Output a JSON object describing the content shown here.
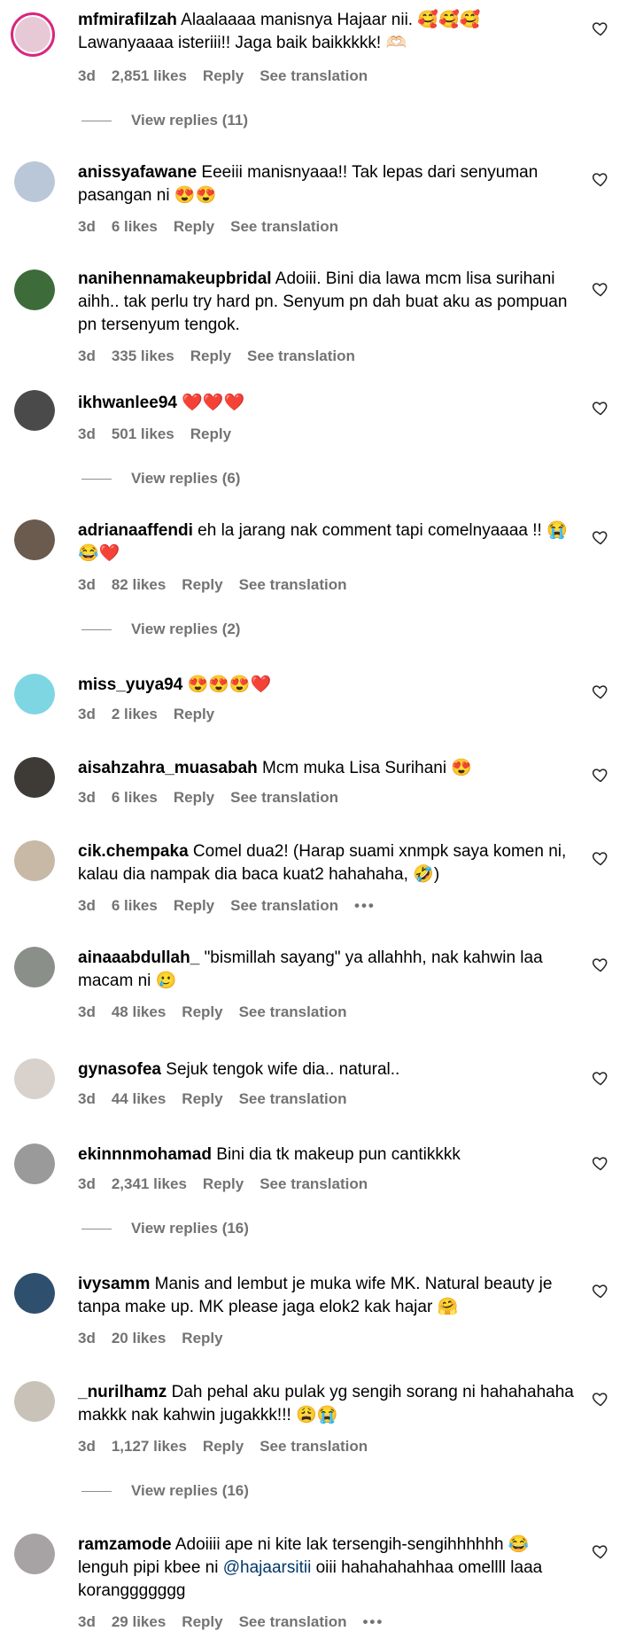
{
  "comments": [
    {
      "username": "mfmirafilzah",
      "text": "Alaalaaaa manisnya Hajaar nii. 🥰🥰🥰 Lawanyaaaa isteriii!! Jaga baik baikkkkk! 🫶🏻",
      "time": "3d",
      "likes": "2,851 likes",
      "reply": "Reply",
      "translate": "See translation",
      "view_replies": "View replies (11)",
      "avatar_color": "#e7c9d6"
    },
    {
      "username": "anissyafawane",
      "text": "Eeeiii manisnyaaa!! Tak lepas dari senyuman pasangan ni 😍😍",
      "time": "3d",
      "likes": "6 likes",
      "reply": "Reply",
      "translate": "See translation",
      "avatar_color": "#b9c7d9"
    },
    {
      "username": "nanihennamakeupbridal",
      "text": "Adoiii. Bini dia lawa mcm lisa surihani aihh.. tak perlu try hard pn. Senyum pn dah buat aku as pompuan pn tersenyum tengok.",
      "time": "3d",
      "likes": "335 likes",
      "reply": "Reply",
      "translate": "See translation",
      "avatar_color": "#3d6b3a"
    },
    {
      "username": "ikhwanlee94",
      "text": "❤️❤️❤️",
      "time": "3d",
      "likes": "501 likes",
      "reply": "Reply",
      "view_replies": "View replies (6)",
      "avatar_color": "#4a4a4a"
    },
    {
      "username": "adrianaaffendi",
      "text": "eh la jarang nak comment tapi comelnyaaaa !! 😭😂❤️",
      "time": "3d",
      "likes": "82 likes",
      "reply": "Reply",
      "translate": "See translation",
      "view_replies": "View replies (2)",
      "avatar_color": "#6b5a4e"
    },
    {
      "username": "miss_yuya94",
      "text": "😍😍😍❤️",
      "time": "3d",
      "likes": "2 likes",
      "reply": "Reply",
      "avatar_color": "#7fd6e3"
    },
    {
      "username": "aisahzahra_muasabah",
      "text": "Mcm muka Lisa Surihani 😍",
      "time": "3d",
      "likes": "6 likes",
      "reply": "Reply",
      "translate": "See translation",
      "avatar_color": "#3e3a36"
    },
    {
      "username": "cik.chempaka",
      "text": "Comel dua2! (Harap suami xnmpk saya komen ni, kalau dia nampak dia baca kuat2 hahahaha, 🤣)",
      "time": "3d",
      "likes": "6 likes",
      "reply": "Reply",
      "translate": "See translation",
      "more": "•••",
      "avatar_color": "#c7b9a6"
    },
    {
      "username": "ainaaabdullah_",
      "text": "\"bismillah sayang\" ya allahhh, nak kahwin laa macam ni 🥲",
      "time": "3d",
      "likes": "48 likes",
      "reply": "Reply",
      "translate": "See translation",
      "avatar_color": "#8a8f8a"
    },
    {
      "username": "gynasofea",
      "text": "Sejuk tengok wife dia.. natural..",
      "time": "3d",
      "likes": "44 likes",
      "reply": "Reply",
      "translate": "See translation",
      "avatar_color": "#d9d2cc"
    },
    {
      "username": "ekinnnmohamad",
      "text": "Bini dia tk makeup pun cantikkkk",
      "time": "3d",
      "likes": "2,341 likes",
      "reply": "Reply",
      "translate": "See translation",
      "view_replies": "View replies (16)",
      "avatar_color": "#9a9a9a"
    },
    {
      "username": "ivysamm",
      "text": "Manis and lembut je muka wife MK. Natural beauty je tanpa make up. MK please jaga elok2 kak hajar 🤗",
      "time": "3d",
      "likes": "20 likes",
      "reply": "Reply",
      "avatar_color": "#2f4f6e"
    },
    {
      "username": "_nurilhamz",
      "text": "Dah pehal aku pulak yg sengih sorang ni hahahahaha makkk nak kahwin jugakkk!!! 😩😭",
      "time": "3d",
      "likes": "1,127 likes",
      "reply": "Reply",
      "translate": "See translation",
      "view_replies": "View replies (16)",
      "avatar_color": "#c9c2b8"
    },
    {
      "username": "ramzamode",
      "text_before": "Adoiiii ape ni kite lak tersengih-sengihhhhhh 😂 lenguh pipi kbee ni ",
      "mention": "@hajaarsitii",
      "text_after": " oiii hahahahahhaa omellll laaa koranggggggg",
      "time": "3d",
      "likes": "29 likes",
      "reply": "Reply",
      "translate": "See translation",
      "more": "•••",
      "avatar_color": "#a7a2a4"
    }
  ],
  "colors": {
    "meta": "#737373",
    "link": "#00376b",
    "ring": "#d8277f"
  },
  "icons": {
    "like": "heart-outline-icon"
  }
}
